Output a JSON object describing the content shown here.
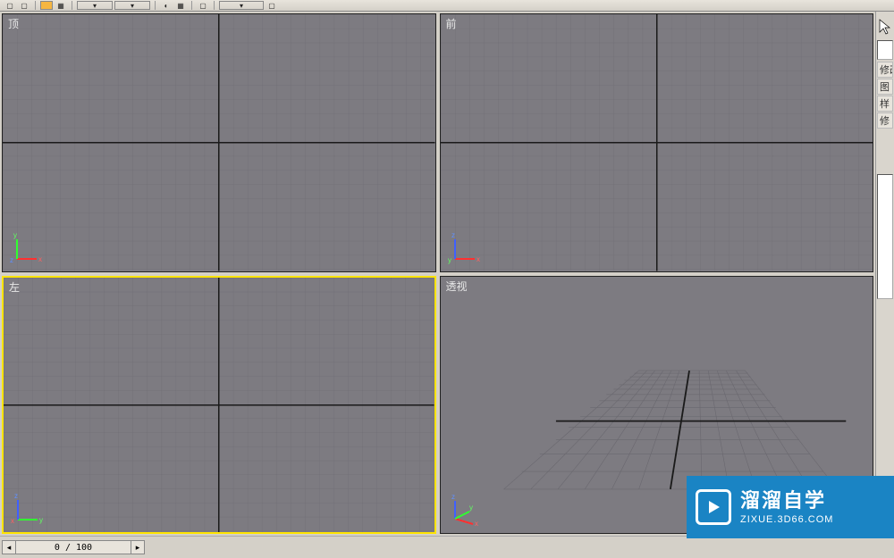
{
  "toolbar": {
    "items": [
      "",
      "",
      "",
      "",
      "",
      "",
      "",
      ""
    ]
  },
  "viewports": {
    "top": {
      "label": "顶",
      "axes": [
        "x",
        "y",
        "z"
      ]
    },
    "front": {
      "label": "前",
      "axes": [
        "x",
        "z",
        "y"
      ]
    },
    "left": {
      "label": "左",
      "axes": [
        "y",
        "z",
        "x"
      ]
    },
    "perspective": {
      "label": "透视",
      "axes": [
        "x",
        "z",
        "y"
      ]
    }
  },
  "active_viewport": "left",
  "command_panel": {
    "modify_label": "修改",
    "shape_label": "图",
    "spline_label": "样",
    "params_label": "修"
  },
  "timeline": {
    "display": "0 / 100",
    "current": 0,
    "total": 100
  },
  "watermark": {
    "title": "溜溜自学",
    "url": "ZIXUE.3D66.COM"
  }
}
